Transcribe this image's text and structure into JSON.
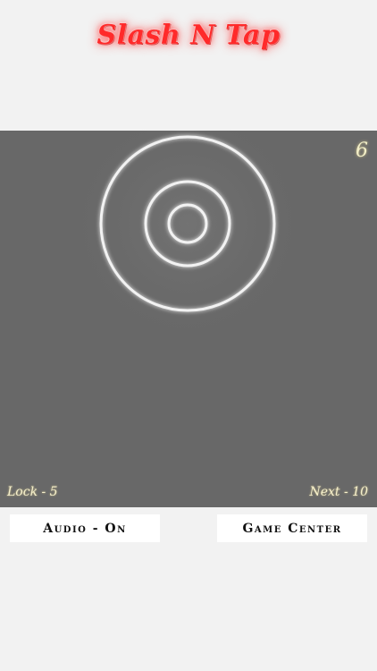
{
  "app": {
    "title": "Slash N Tap"
  },
  "hud": {
    "score": "6",
    "lock_label": "Lock - 5",
    "next_label": "Next - 10"
  },
  "colors": {
    "title": "#ff2a2a",
    "board": "#686868",
    "ring": "#f2f2f2",
    "hud_text": "#f6f0cc"
  },
  "controls": {
    "audio_button": "Audio - On",
    "game_center_button": "Game Center"
  }
}
